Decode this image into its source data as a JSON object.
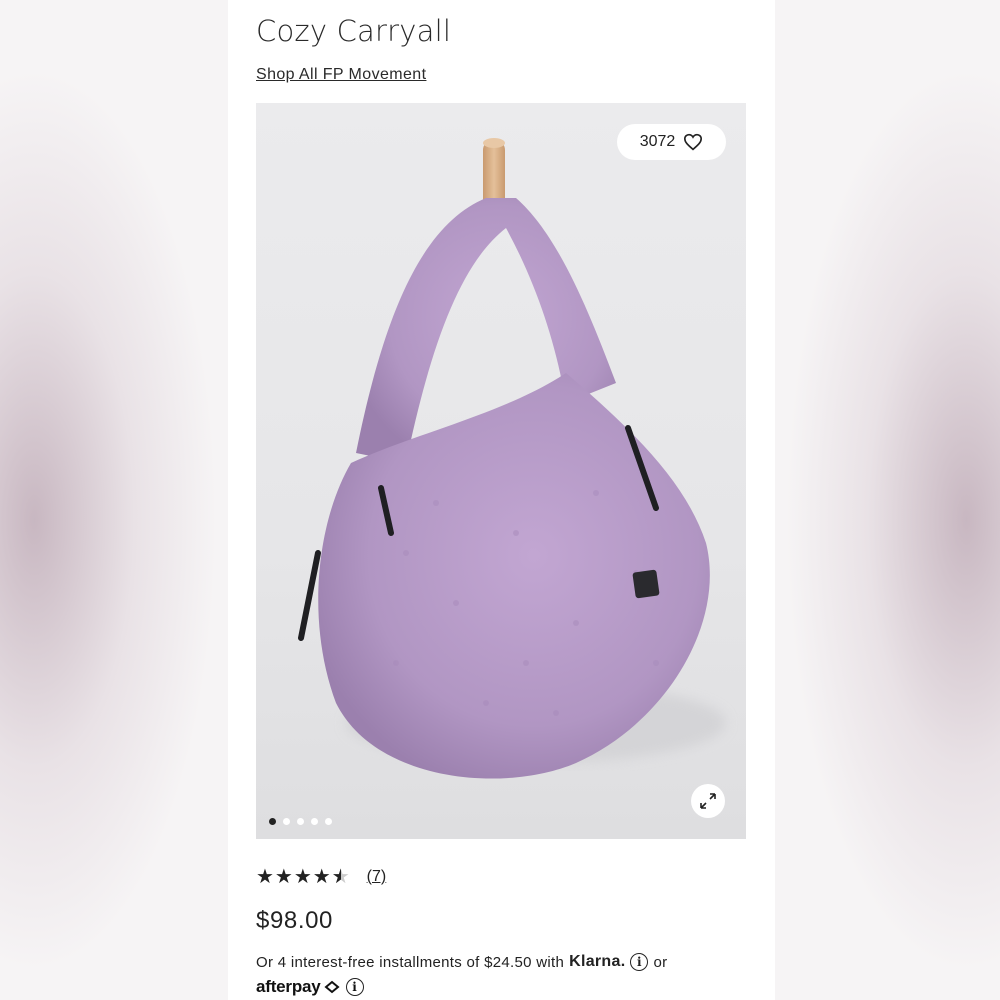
{
  "product": {
    "title": "Cozy Carryall",
    "shop_link": "Shop All FP Movement",
    "price": "$98.00",
    "rating_stars": "★★★★★",
    "rating_value": 4.5,
    "review_count": "(7)"
  },
  "image": {
    "wishlist_count": "3072",
    "carousel_count": 5,
    "carousel_active_index": 0,
    "colors": {
      "bag": "#b79ac9",
      "peg": "#d7b08a",
      "wall": "#e8e8ea"
    }
  },
  "payment": {
    "installments_text": "Or 4 interest-free installments of $24.50 with",
    "klarna_label": "Klarna.",
    "or_text": "or",
    "afterpay_label": "afterpay"
  },
  "icons": [
    "heart-icon",
    "expand-icon",
    "info-icon",
    "afterpay-logo-icon"
  ]
}
